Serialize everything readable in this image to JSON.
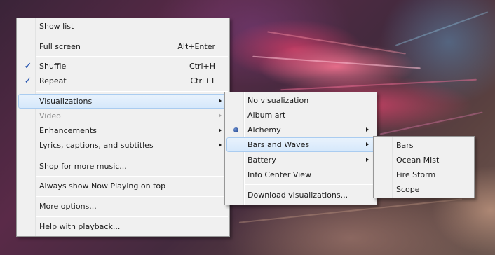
{
  "main_menu": {
    "items": [
      {
        "label": "Show list"
      },
      {
        "label": "Full screen",
        "shortcut": "Alt+Enter"
      },
      {
        "label": "Shuffle",
        "shortcut": "Ctrl+H",
        "checked": true
      },
      {
        "label": "Repeat",
        "shortcut": "Ctrl+T",
        "checked": true
      },
      {
        "label": "Visualizations",
        "submenu": true,
        "highlighted": true
      },
      {
        "label": "Video",
        "submenu": true,
        "disabled": true
      },
      {
        "label": "Enhancements",
        "submenu": true
      },
      {
        "label": "Lyrics, captions, and subtitles",
        "submenu": true
      },
      {
        "label": "Shop for more music..."
      },
      {
        "label": "Always show Now Playing on top"
      },
      {
        "label": "More options..."
      },
      {
        "label": "Help with playback..."
      }
    ]
  },
  "visualizations_menu": {
    "items": [
      {
        "label": "No visualization"
      },
      {
        "label": "Album art"
      },
      {
        "label": "Alchemy",
        "submenu": true,
        "selected": true
      },
      {
        "label": "Bars and Waves",
        "submenu": true,
        "highlighted": true
      },
      {
        "label": "Battery",
        "submenu": true
      },
      {
        "label": "Info Center View"
      },
      {
        "label": "Download visualizations..."
      }
    ]
  },
  "bars_waves_menu": {
    "items": [
      {
        "label": "Bars"
      },
      {
        "label": "Ocean Mist"
      },
      {
        "label": "Fire Storm"
      },
      {
        "label": "Scope"
      }
    ]
  },
  "icons": {
    "check": "✓",
    "submenu_arrow": "chevron-right-icon",
    "radio_bullet": "radio-bullet-icon"
  },
  "colors": {
    "menu_background": "#f0f0f0",
    "highlight": "#d6e8fb",
    "check_color": "#1e4fae"
  }
}
